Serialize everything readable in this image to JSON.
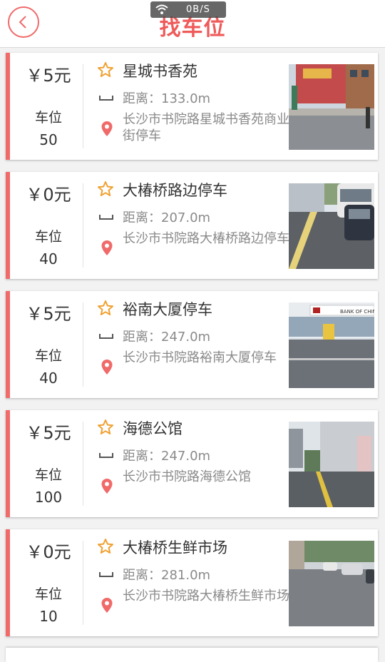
{
  "header": {
    "title": "找车位",
    "network_speed": "0B/S"
  },
  "list_labels": {
    "spot_label": "车位"
  },
  "lots": [
    {
      "price": "￥5元",
      "spots": "50",
      "name": "星城书香苑",
      "distance": "距离：133.0m",
      "address": "长沙市书院路星城书香苑商业街停车"
    },
    {
      "price": "￥0元",
      "spots": "40",
      "name": "大椿桥路边停车",
      "distance": "距离：207.0m",
      "address": "长沙市书院路大椿桥路边停车"
    },
    {
      "price": "￥5元",
      "spots": "40",
      "name": "裕南大厦停车",
      "distance": "距离：247.0m",
      "address": "长沙市书院路裕南大厦停车"
    },
    {
      "price": "￥5元",
      "spots": "100",
      "name": "海德公馆",
      "distance": "距离：247.0m",
      "address": "长沙市书院路海德公馆"
    },
    {
      "price": "￥0元",
      "spots": "10",
      "name": "大椿桥生鲜市场",
      "distance": "距离：281.0m",
      "address": "长沙市书院路大椿桥生鲜市场"
    }
  ],
  "photo_signs": {
    "bank_text": "BANK OF CHINA"
  },
  "colors": {
    "accent": "#f06a6a",
    "star": "#f0a030",
    "pin": "#f06a6a"
  }
}
